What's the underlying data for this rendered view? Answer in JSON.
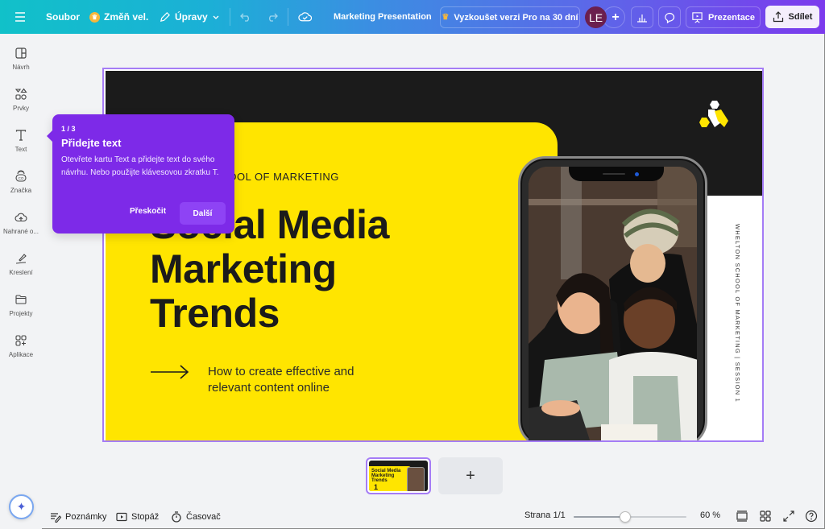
{
  "topbar": {
    "menu_icon": "hamburger-icon",
    "file": "Soubor",
    "resize": "Změň vel.",
    "edit": "Úpravy",
    "title": "Marketing Presentation",
    "pro_trial": "Vyzkoušet verzi Pro na 30 dní",
    "avatar_initials": "LE",
    "present": "Prezentace",
    "share": "Sdílet"
  },
  "sidebar": {
    "items": [
      {
        "label": "Návrh",
        "icon": "layout-icon"
      },
      {
        "label": "Prvky",
        "icon": "shapes-icon"
      },
      {
        "label": "Text",
        "icon": "text-icon"
      },
      {
        "label": "Značka",
        "icon": "brand-icon"
      },
      {
        "label": "Nahrané o...",
        "icon": "upload-cloud-icon"
      },
      {
        "label": "Kreslení",
        "icon": "draw-icon"
      },
      {
        "label": "Projekty",
        "icon": "folder-icon"
      },
      {
        "label": "Aplikace",
        "icon": "apps-icon"
      }
    ]
  },
  "tour": {
    "step": "1 / 3",
    "title": "Přidejte text",
    "body": "Otevřete kartu Text a přidejte text do svého návrhu. Nebo použijte klávesovou zkratku T.",
    "skip": "Přeskočit",
    "next": "Další"
  },
  "slide": {
    "school": "WHELTON SCHOOL OF MARKETING",
    "title_line1": "Social Media",
    "title_line2": "Marketing",
    "title_line3": "Trends",
    "subtitle_line1": "How to create effective and",
    "subtitle_line2": "relevant content online",
    "vertical_text": "WHELTON SCHOOL OF MARKETING | SESSION 1",
    "colors": {
      "yellow": "#ffe500",
      "black": "#1b1b1b"
    }
  },
  "pages": {
    "thumb_number": "1",
    "thumb_title": "Social Media Marketing Trends",
    "add_label": "+"
  },
  "bottombar": {
    "notes": "Poznámky",
    "footage": "Stopáž",
    "timer": "Časovač",
    "page_indicator": "Strana 1/1",
    "zoom_percent": 60,
    "zoom_label": "60 %",
    "zoom_slider_fraction": 0.46
  },
  "colors": {
    "accent": "#7d2ae8",
    "selection": "#a57cf6"
  }
}
